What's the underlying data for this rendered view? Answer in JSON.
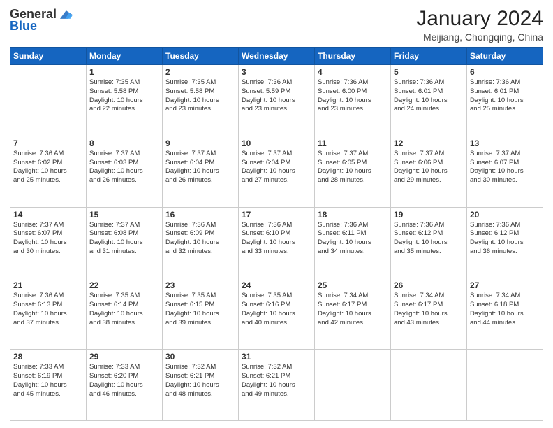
{
  "header": {
    "logo_general": "General",
    "logo_blue": "Blue",
    "month_title": "January 2024",
    "subtitle": "Meijiang, Chongqing, China"
  },
  "days_of_week": [
    "Sunday",
    "Monday",
    "Tuesday",
    "Wednesday",
    "Thursday",
    "Friday",
    "Saturday"
  ],
  "weeks": [
    [
      {
        "day": "",
        "content": ""
      },
      {
        "day": "1",
        "content": "Sunrise: 7:35 AM\nSunset: 5:58 PM\nDaylight: 10 hours\nand 22 minutes."
      },
      {
        "day": "2",
        "content": "Sunrise: 7:35 AM\nSunset: 5:58 PM\nDaylight: 10 hours\nand 23 minutes."
      },
      {
        "day": "3",
        "content": "Sunrise: 7:36 AM\nSunset: 5:59 PM\nDaylight: 10 hours\nand 23 minutes."
      },
      {
        "day": "4",
        "content": "Sunrise: 7:36 AM\nSunset: 6:00 PM\nDaylight: 10 hours\nand 23 minutes."
      },
      {
        "day": "5",
        "content": "Sunrise: 7:36 AM\nSunset: 6:01 PM\nDaylight: 10 hours\nand 24 minutes."
      },
      {
        "day": "6",
        "content": "Sunrise: 7:36 AM\nSunset: 6:01 PM\nDaylight: 10 hours\nand 25 minutes."
      }
    ],
    [
      {
        "day": "7",
        "content": "Sunrise: 7:36 AM\nSunset: 6:02 PM\nDaylight: 10 hours\nand 25 minutes."
      },
      {
        "day": "8",
        "content": "Sunrise: 7:37 AM\nSunset: 6:03 PM\nDaylight: 10 hours\nand 26 minutes."
      },
      {
        "day": "9",
        "content": "Sunrise: 7:37 AM\nSunset: 6:04 PM\nDaylight: 10 hours\nand 26 minutes."
      },
      {
        "day": "10",
        "content": "Sunrise: 7:37 AM\nSunset: 6:04 PM\nDaylight: 10 hours\nand 27 minutes."
      },
      {
        "day": "11",
        "content": "Sunrise: 7:37 AM\nSunset: 6:05 PM\nDaylight: 10 hours\nand 28 minutes."
      },
      {
        "day": "12",
        "content": "Sunrise: 7:37 AM\nSunset: 6:06 PM\nDaylight: 10 hours\nand 29 minutes."
      },
      {
        "day": "13",
        "content": "Sunrise: 7:37 AM\nSunset: 6:07 PM\nDaylight: 10 hours\nand 30 minutes."
      }
    ],
    [
      {
        "day": "14",
        "content": "Sunrise: 7:37 AM\nSunset: 6:07 PM\nDaylight: 10 hours\nand 30 minutes."
      },
      {
        "day": "15",
        "content": "Sunrise: 7:37 AM\nSunset: 6:08 PM\nDaylight: 10 hours\nand 31 minutes."
      },
      {
        "day": "16",
        "content": "Sunrise: 7:36 AM\nSunset: 6:09 PM\nDaylight: 10 hours\nand 32 minutes."
      },
      {
        "day": "17",
        "content": "Sunrise: 7:36 AM\nSunset: 6:10 PM\nDaylight: 10 hours\nand 33 minutes."
      },
      {
        "day": "18",
        "content": "Sunrise: 7:36 AM\nSunset: 6:11 PM\nDaylight: 10 hours\nand 34 minutes."
      },
      {
        "day": "19",
        "content": "Sunrise: 7:36 AM\nSunset: 6:12 PM\nDaylight: 10 hours\nand 35 minutes."
      },
      {
        "day": "20",
        "content": "Sunrise: 7:36 AM\nSunset: 6:12 PM\nDaylight: 10 hours\nand 36 minutes."
      }
    ],
    [
      {
        "day": "21",
        "content": "Sunrise: 7:36 AM\nSunset: 6:13 PM\nDaylight: 10 hours\nand 37 minutes."
      },
      {
        "day": "22",
        "content": "Sunrise: 7:35 AM\nSunset: 6:14 PM\nDaylight: 10 hours\nand 38 minutes."
      },
      {
        "day": "23",
        "content": "Sunrise: 7:35 AM\nSunset: 6:15 PM\nDaylight: 10 hours\nand 39 minutes."
      },
      {
        "day": "24",
        "content": "Sunrise: 7:35 AM\nSunset: 6:16 PM\nDaylight: 10 hours\nand 40 minutes."
      },
      {
        "day": "25",
        "content": "Sunrise: 7:34 AM\nSunset: 6:17 PM\nDaylight: 10 hours\nand 42 minutes."
      },
      {
        "day": "26",
        "content": "Sunrise: 7:34 AM\nSunset: 6:17 PM\nDaylight: 10 hours\nand 43 minutes."
      },
      {
        "day": "27",
        "content": "Sunrise: 7:34 AM\nSunset: 6:18 PM\nDaylight: 10 hours\nand 44 minutes."
      }
    ],
    [
      {
        "day": "28",
        "content": "Sunrise: 7:33 AM\nSunset: 6:19 PM\nDaylight: 10 hours\nand 45 minutes."
      },
      {
        "day": "29",
        "content": "Sunrise: 7:33 AM\nSunset: 6:20 PM\nDaylight: 10 hours\nand 46 minutes."
      },
      {
        "day": "30",
        "content": "Sunrise: 7:32 AM\nSunset: 6:21 PM\nDaylight: 10 hours\nand 48 minutes."
      },
      {
        "day": "31",
        "content": "Sunrise: 7:32 AM\nSunset: 6:21 PM\nDaylight: 10 hours\nand 49 minutes."
      },
      {
        "day": "",
        "content": ""
      },
      {
        "day": "",
        "content": ""
      },
      {
        "day": "",
        "content": ""
      }
    ]
  ]
}
